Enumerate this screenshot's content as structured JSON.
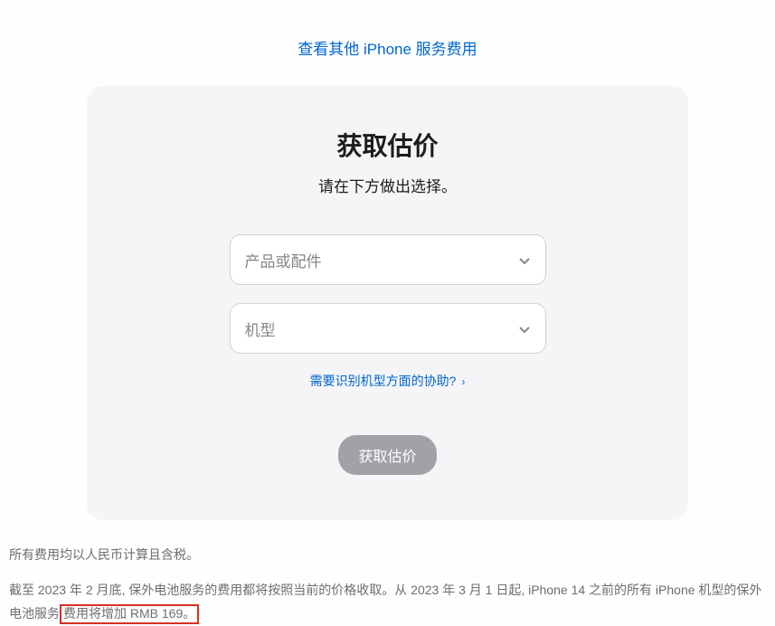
{
  "topLink": {
    "label": "查看其他 iPhone 服务费用"
  },
  "card": {
    "title": "获取估价",
    "subtitle": "请在下方做出选择。",
    "select1": {
      "placeholder": "产品或配件"
    },
    "select2": {
      "placeholder": "机型"
    },
    "helpLink": {
      "label": "需要识别机型方面的协助?"
    },
    "submit": {
      "label": "获取估价"
    }
  },
  "footer": {
    "note1": "所有费用均以人民币计算且含税。",
    "note2_part1": "截至 2023 年 2 月底, 保外电池服务的费用都将按照当前的价格收取。从 2023 年 3 月 1 日起, iPhone 14 之前的所有 iPhone 机型的保外电池服务",
    "note2_highlight": "费用将增加 RMB 169。"
  }
}
